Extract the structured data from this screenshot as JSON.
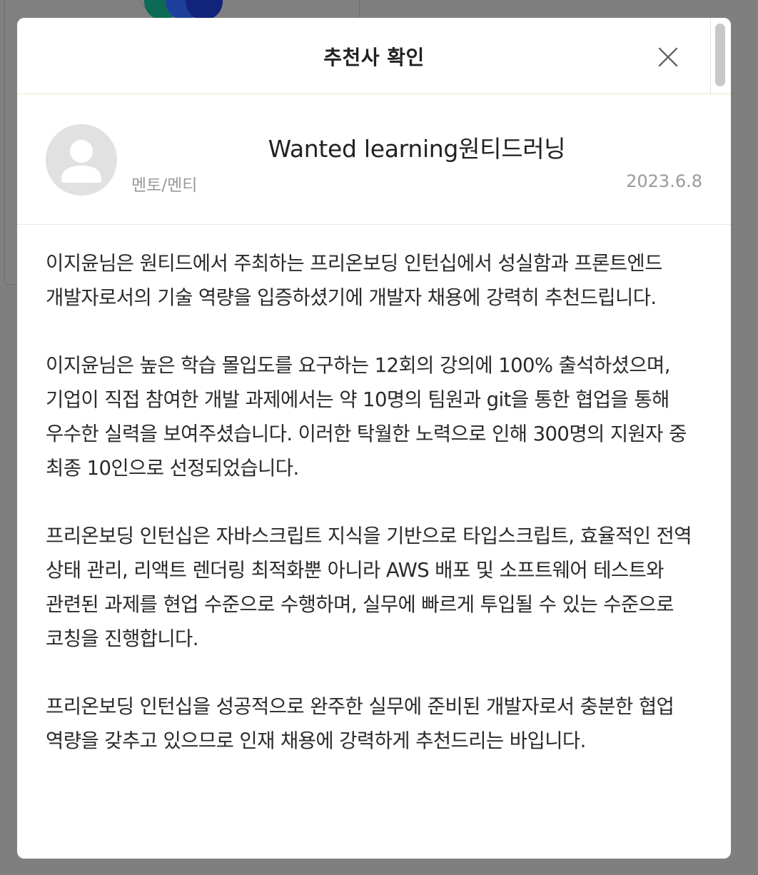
{
  "modal": {
    "title": "추천사 확인",
    "close_label": "닫기"
  },
  "recommender": {
    "name": "Wanted learning원티드러닝",
    "relation": "멘토/멘티",
    "date": "2023.6.8"
  },
  "letter": {
    "paragraphs": [
      "이지윤님은 원티드에서 주최하는 프리온보딩 인턴십에서 성실함과 프론트엔드 개발자로서의 기술 역량을 입증하셨기에 개발자 채용에 강력히 추천드립니다.",
      "이지윤님은 높은 학습 몰입도를 요구하는 12회의 강의에 100% 출석하셨으며, 기업이 직접 참여한 개발 과제에서는 약 10명의 팀원과 git을 통한 협업을 통해 우수한 실력을 보여주셨습니다. 이러한 탁월한 노력으로 인해 300명의 지원자 중 최종 10인으로 선정되었습니다.",
      "프리온보딩 인턴십은 자바스크립트 지식을 기반으로 타입스크립트, 효율적인 전역 상태 관리, 리액트 렌더링 최적화뿐 아니라 AWS 배포 및 소프트웨어 테스트와 관련된 과제를 현업 수준으로 수행하며, 실무에 빠르게 투입될 수 있는 수준으로 코칭을 진행합니다.",
      "프리온보딩 인턴십을 성공적으로 완주한 실무에 준비된 개발자로서 충분한 협업 역량을 갖추고 있으므로 인재 채용에 강력하게 추천드리는 바입니다."
    ]
  },
  "icons": {
    "close": "close-icon",
    "avatar": "user-avatar-icon"
  },
  "colors": {
    "overlay": "#7f7f7f",
    "modal_bg": "#ffffff",
    "text": "#2a2a2a",
    "muted": "#9a9a9a"
  }
}
